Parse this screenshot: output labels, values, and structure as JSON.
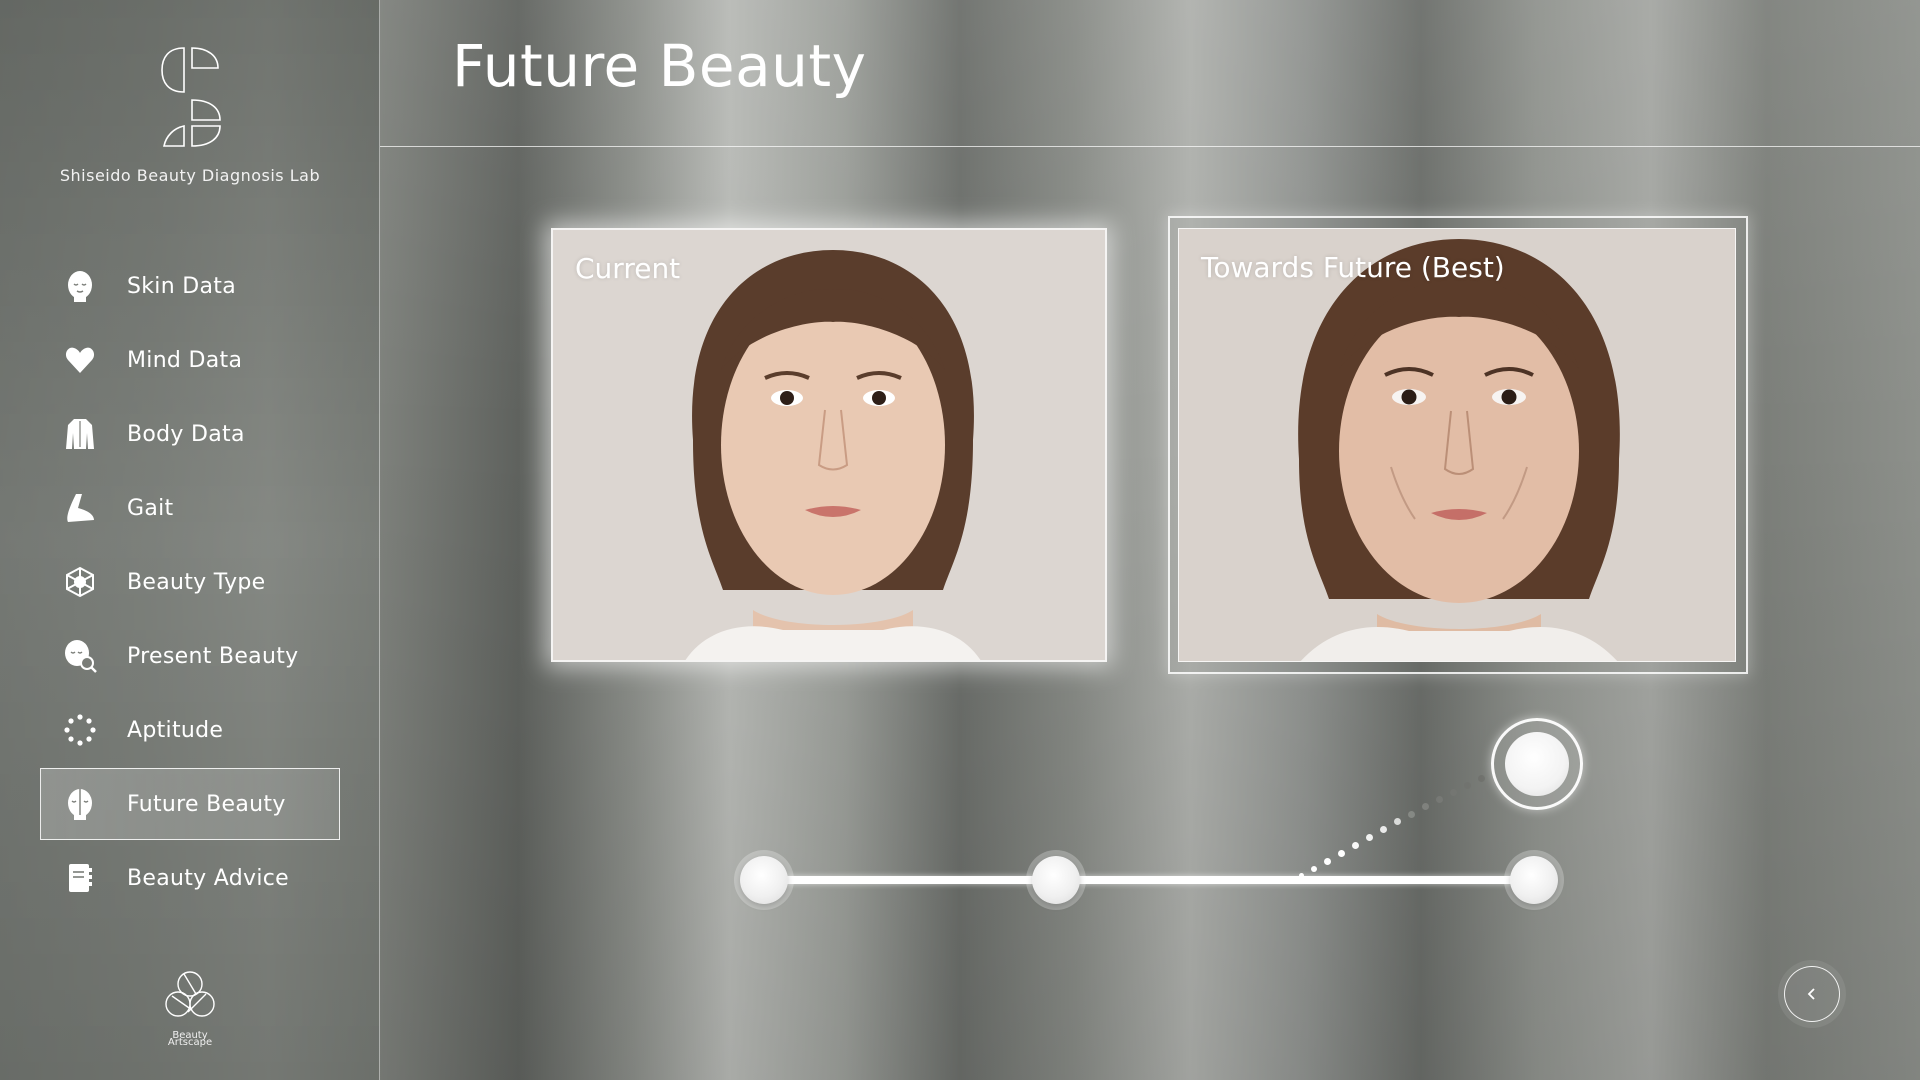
{
  "brand": {
    "name": "Shiseido Beauty Diagnosis Lab",
    "logo_icon": "shiseido-s-logo"
  },
  "header": {
    "title": "Future Beauty"
  },
  "sidebar": {
    "items": [
      {
        "label": "Skin Data",
        "icon": "face-icon",
        "active": false
      },
      {
        "label": "Mind Data",
        "icon": "heart-icon",
        "active": false
      },
      {
        "label": "Body Data",
        "icon": "torso-icon",
        "active": false
      },
      {
        "label": "Gait",
        "icon": "foot-icon",
        "active": false
      },
      {
        "label": "Beauty Type",
        "icon": "hexagon-cube-icon",
        "active": false
      },
      {
        "label": "Present Beauty",
        "icon": "face-magnifier-icon",
        "active": false
      },
      {
        "label": "Aptitude",
        "icon": "dotted-circle-icon",
        "active": false
      },
      {
        "label": "Future Beauty",
        "icon": "half-face-icon",
        "active": true
      },
      {
        "label": "Beauty Advice",
        "icon": "notebook-icon",
        "active": false
      }
    ]
  },
  "footer_logo": {
    "text_line1": "Beauty",
    "text_line2": "Artscape"
  },
  "panels": {
    "current": {
      "label": "Current"
    },
    "future": {
      "label": "Towards Future (Best)"
    }
  },
  "slider": {
    "stops": 3,
    "selected_stop": 3
  },
  "colors": {
    "accent": "#ffffff",
    "sidebar_bg": "#6b6f6a",
    "photo_bg": "#d8d2cd"
  }
}
